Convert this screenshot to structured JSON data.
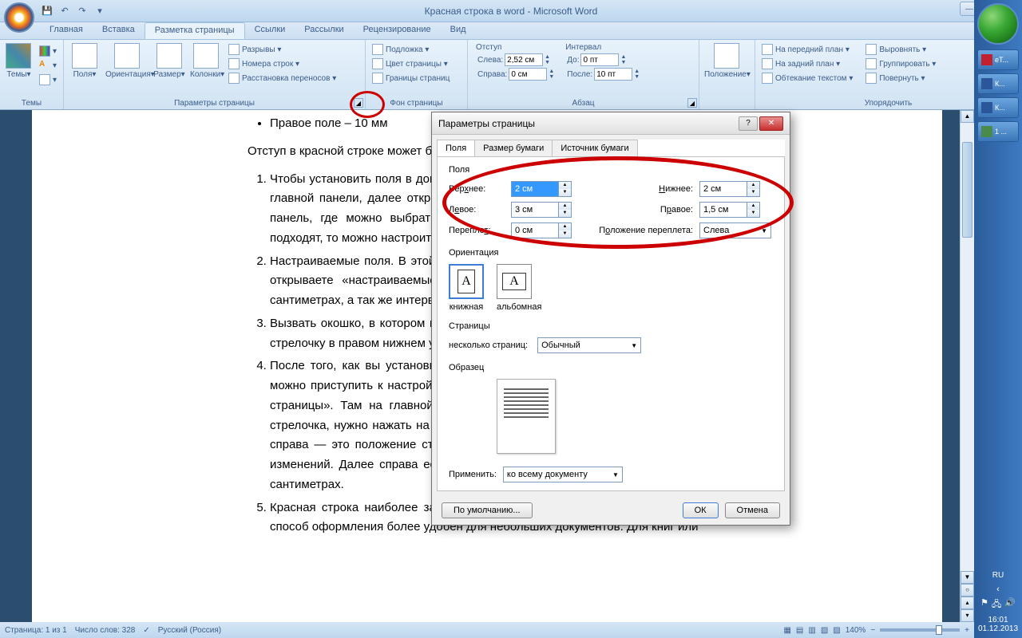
{
  "title": "Красная строка в word - Microsoft Word",
  "qat": {
    "save": "💾",
    "undo": "↶",
    "redo": "↷"
  },
  "menu": {
    "tabs": [
      "Главная",
      "Вставка",
      "Разметка страницы",
      "Ссылки",
      "Рассылки",
      "Рецензирование",
      "Вид"
    ],
    "active_index": 2
  },
  "ribbon": {
    "themes": {
      "label": "Темы",
      "btn": "Темы"
    },
    "page_setup": {
      "label": "Параметры страницы",
      "margins": "Поля",
      "orientation": "Ориентация",
      "size": "Размер",
      "columns": "Колонки",
      "breaks": "Разрывы ▾",
      "line_numbers": "Номера строк ▾",
      "hyphenation": "Расстановка переносов ▾"
    },
    "page_bg": {
      "label": "Фон страницы",
      "watermark": "Подложка ▾",
      "color": "Цвет страницы ▾",
      "borders": "Границы страниц"
    },
    "paragraph": {
      "label": "Абзац",
      "indent_label": "Отступ",
      "spacing_label": "Интервал",
      "left_l": "Слева:",
      "left_v": "2,52 см",
      "right_l": "Справа:",
      "right_v": "0 см",
      "before_l": "До:",
      "before_v": "0 пт",
      "after_l": "После:",
      "after_v": "10 пт"
    },
    "position": {
      "label": "Положение",
      "btn": "Положение"
    },
    "arrange": {
      "label": "Упорядочить",
      "front": "На передний план ▾",
      "back": "На задний план ▾",
      "wrap": "Обтекание текстом ▾",
      "align": "Выровнять ▾",
      "group": "Группировать ▾",
      "rotate": "Повернуть ▾"
    }
  },
  "document": {
    "bullet": "Правое поле – 10 мм",
    "p1": "Отступ в красной строке может быть настроен 5 способами:",
    "list": [
      "Чтобы установить поля в документе, зайдите во вкладку «Разметка страницы» на главной панели, далее откройте «параметры страницы». Здесь откроется новая панель, где можно выбрать один из предложенных шаблонов. Если они не подходят, то можно настроить поля в ручную (смотри пункт 2)",
      "Настраиваемые поля. В этой же самой панели открываете раздел «поля», далее открываете «настраиваемые поля». В открывшемся окне вводите данные в сантиметрах, а так же интервалы отступа и переплета.",
      "Вызвать окошко, в котором можно настроить поля вручную, нажав на маленькую стрелочку в правом нижнем углу «параметров страницы».",
      " После того, как вы установили поля документа, в этой же «Разметке страницы можно приступить к настройке красной строки. Переходим во вкладку «Разметка страницы». Там на главной панели в конце каждого раздела есть маленькая стрелочка, нужно нажать на неё. Здесь в разделе «отступ» ищем надпись слева/справа — это положение строки относительно страницы до и после внесенных изменений. Далее справа есть окошко, в котором вы вводите размер отступа в сантиметрах.",
      "Красная строка наиболее заметна, если между абзацами есть интервал.  Такой способ оформления более удобен для небольших документов. Для книг или"
    ]
  },
  "dialog": {
    "title": "Параметры страницы",
    "tabs": [
      "Поля",
      "Размер бумаги",
      "Источник бумаги"
    ],
    "fields_label": "Поля",
    "top_l": "Верхнее:",
    "top_v": "2 см",
    "bottom_l": "Нижнее:",
    "bottom_v": "2 см",
    "left_l": "Левое:",
    "left_v": "3 см",
    "right_l": "Правое:",
    "right_v": "1,5 см",
    "gutter_l": "Переплет:",
    "gutter_v": "0 см",
    "gutter_pos_l": "Положение переплета:",
    "gutter_pos_v": "Слева",
    "orient_label": "Ориентация",
    "portrait": "книжная",
    "landscape": "альбомная",
    "pages_label": "Страницы",
    "multi_l": "несколько страниц:",
    "multi_v": "Обычный",
    "sample_label": "Образец",
    "apply_l": "Применить:",
    "apply_v": "ко всему документу",
    "default_btn": "По умолчанию...",
    "ok": "ОК",
    "cancel": "Отмена"
  },
  "status": {
    "page": "Страница: 1 из 1",
    "words": "Число слов: 328",
    "lang": "Русский (Россия)",
    "zoom": "140%"
  },
  "taskbar": {
    "items": [
      {
        "icon": "Y",
        "label": "еТ...",
        "bg": "#c02030"
      },
      {
        "icon": "W",
        "label": "К...",
        "bg": "#2b579a"
      },
      {
        "icon": "W",
        "label": "К...",
        "bg": "#2b579a"
      },
      {
        "icon": "●",
        "label": "1 ...",
        "bg": "#4a8a4a"
      }
    ],
    "lang": "RU",
    "time": "16:01",
    "date": "01.12.2013"
  }
}
